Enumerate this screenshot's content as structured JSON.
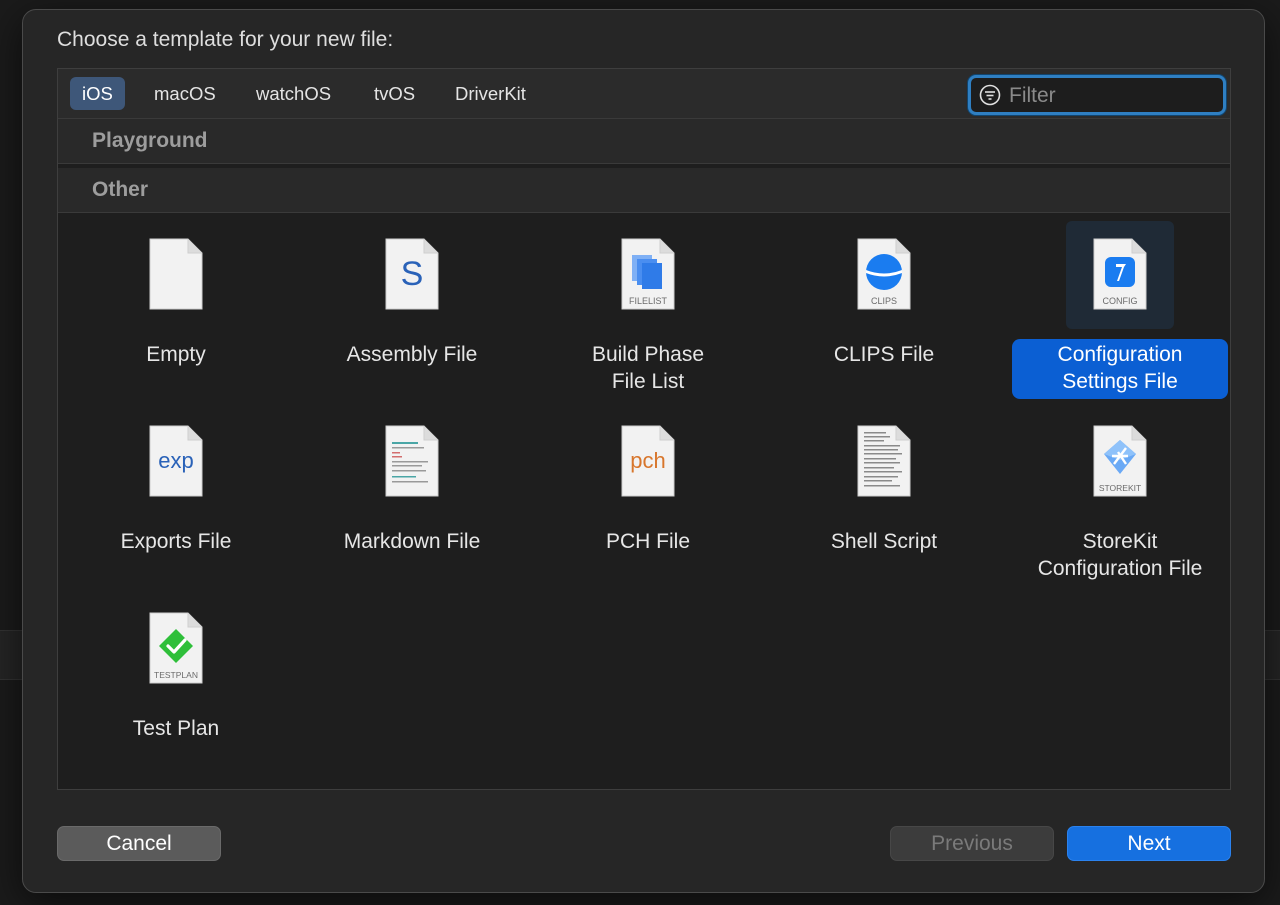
{
  "heading": "Choose a template for your new file:",
  "tabs": [
    {
      "label": "iOS",
      "active": true
    },
    {
      "label": "macOS",
      "active": false
    },
    {
      "label": "watchOS",
      "active": false
    },
    {
      "label": "tvOS",
      "active": false
    },
    {
      "label": "DriverKit",
      "active": false
    }
  ],
  "filter": {
    "placeholder": "Filter",
    "value": "",
    "icon": "filter-icon"
  },
  "sections": {
    "playground": "Playground",
    "other": "Other"
  },
  "templates": [
    {
      "name": "Empty",
      "icon": "empty-file-icon",
      "badge": "",
      "selected": false
    },
    {
      "name": "Assembly File",
      "icon": "assembly-file-icon",
      "badge": "",
      "glyph": "S",
      "selected": false
    },
    {
      "name": "Build Phase File List",
      "line1": "Build Phase",
      "line2": "File List",
      "icon": "filelist-icon",
      "badge": "FILELIST",
      "selected": false
    },
    {
      "name": "CLIPS File",
      "icon": "clips-icon",
      "badge": "CLIPS",
      "selected": false
    },
    {
      "name": "Configuration Settings File",
      "line1": "Configuration",
      "line2": "Settings File",
      "icon": "config-icon",
      "badge": "CONFIG",
      "selected": true
    },
    {
      "name": "Exports File",
      "icon": "exports-file-icon",
      "badge": "",
      "glyph": "exp",
      "selected": false
    },
    {
      "name": "Markdown File",
      "icon": "markdown-file-icon",
      "badge": "",
      "selected": false
    },
    {
      "name": "PCH File",
      "icon": "pch-file-icon",
      "badge": "",
      "glyph": "pch",
      "selected": false
    },
    {
      "name": "Shell Script",
      "icon": "shell-script-icon",
      "badge": "",
      "selected": false
    },
    {
      "name": "StoreKit Configuration File",
      "line1": "StoreKit",
      "line2": "Configuration File",
      "icon": "storekit-icon",
      "badge": "STOREKIT",
      "selected": false
    },
    {
      "name": "Test Plan",
      "icon": "testplan-icon",
      "badge": "TESTPLAN",
      "selected": false
    }
  ],
  "buttons": {
    "cancel": "Cancel",
    "previous": "Previous",
    "next": "Next"
  },
  "colors": {
    "accent": "#0b5fd3",
    "tab_active": "#3e5779",
    "focus_ring": "#2f7fc2"
  }
}
